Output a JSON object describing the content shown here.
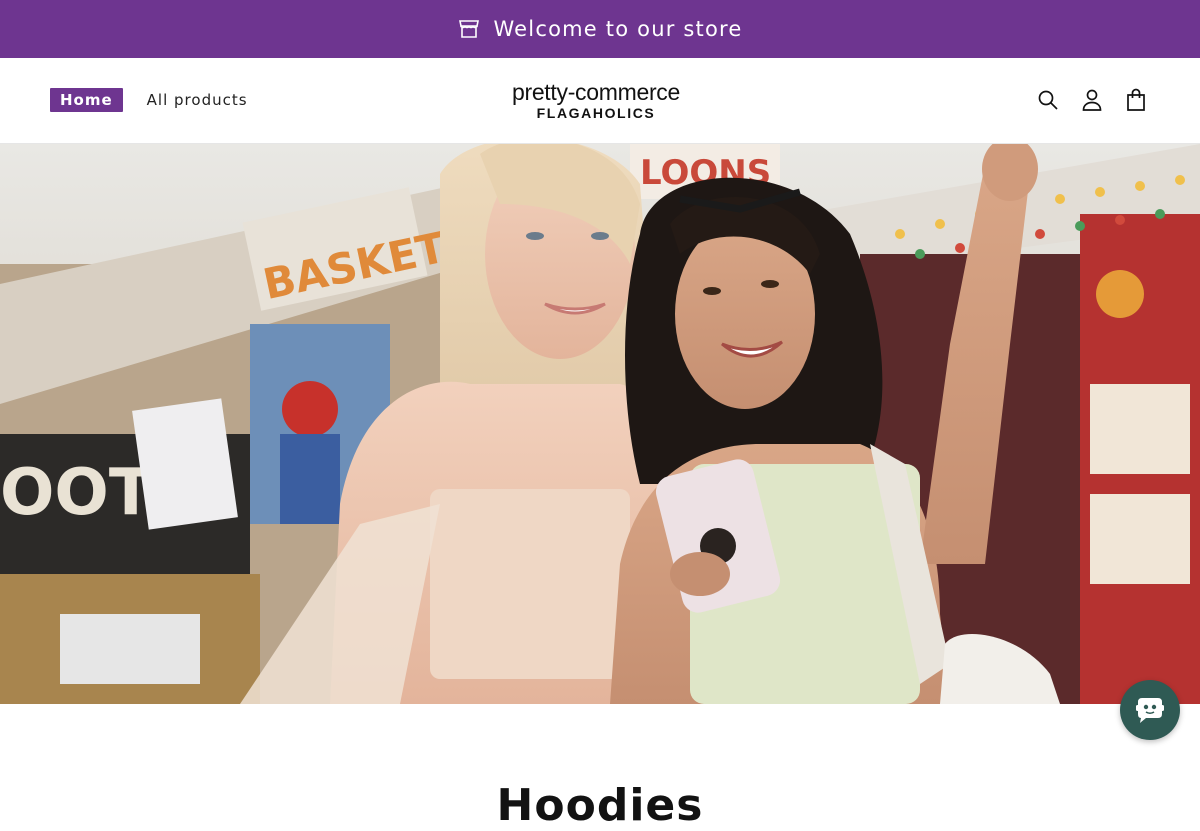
{
  "announcement": {
    "text": "Welcome to our store",
    "icon": "store-icon"
  },
  "nav": {
    "home_label": "Home",
    "all_products_label": "All products"
  },
  "logo": {
    "line1": "pretty-commerce",
    "line2": "FLAGAHOLICS"
  },
  "header_icons": [
    "search-icon",
    "account-icon",
    "cart-icon"
  ],
  "hero": {
    "image_description_signs": [
      "BASKETBALL",
      "LOONS",
      "SHOOT"
    ]
  },
  "section": {
    "heading": "Hoodies"
  },
  "chat": {
    "icon": "chat-bot-icon"
  },
  "colors": {
    "brand": "#6e3590",
    "chat": "#2f5a54"
  }
}
